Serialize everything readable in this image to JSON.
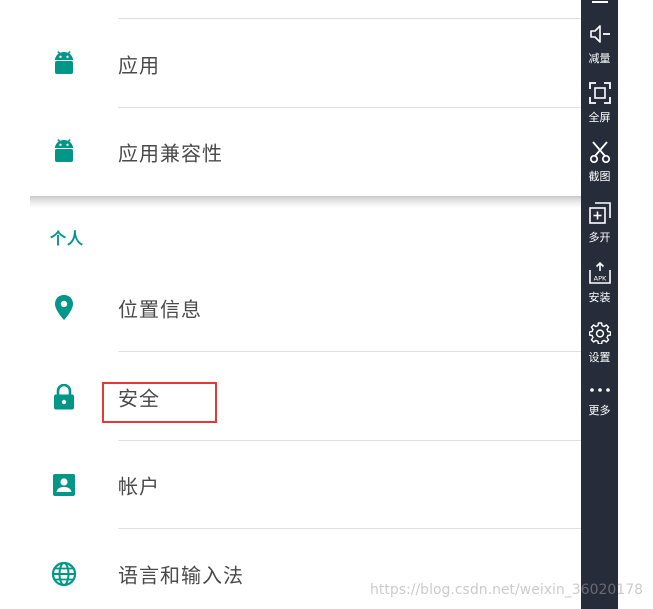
{
  "settings": {
    "items_top": [
      {
        "label": "应用",
        "icon": "android-icon"
      },
      {
        "label": "应用兼容性",
        "icon": "android-icon"
      }
    ],
    "section_title": "个人",
    "items_personal": [
      {
        "label": "位置信息",
        "icon": "location-pin-icon"
      },
      {
        "label": "安全",
        "icon": "lock-icon"
      },
      {
        "label": "帐户",
        "icon": "account-box-icon"
      },
      {
        "label": "语言和输入法",
        "icon": "globe-icon"
      }
    ],
    "accent_color": "#009688",
    "highlight_color": "#e53935"
  },
  "sidebar": {
    "background": "#262c3a",
    "tools": [
      {
        "label": "减量",
        "icon": "volume-down-icon"
      },
      {
        "label": "全屏",
        "icon": "fullscreen-icon"
      },
      {
        "label": "截图",
        "icon": "scissors-icon"
      },
      {
        "label": "多开",
        "icon": "multi-instance-icon"
      },
      {
        "label": "安装",
        "icon": "apk-install-icon"
      },
      {
        "label": "设置",
        "icon": "gear-icon"
      },
      {
        "label": "更多",
        "icon": "more-dots-icon"
      }
    ]
  },
  "watermark": "https://blog.csdn.net/weixin_36020178"
}
